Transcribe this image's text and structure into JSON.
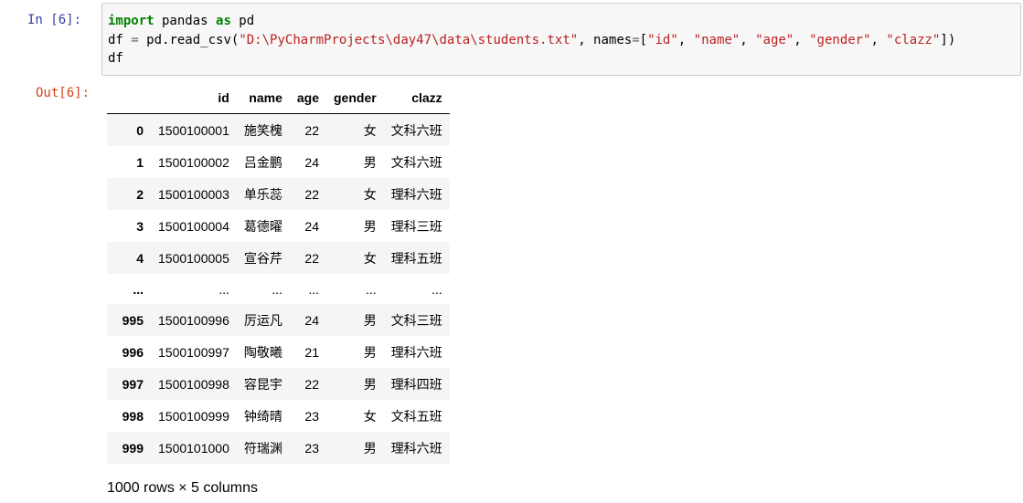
{
  "cell": {
    "in_prompt": "In  [6]:",
    "out_prompt": "Out[6]:",
    "code_lines": [
      {
        "kw1": "import",
        "t1": " pandas ",
        "kw2": "as",
        "t2": " pd"
      },
      {
        "t1": "df ",
        "op1": "=",
        "t2": " pd.read_csv(",
        "s1": "\"D:\\PyCharmProjects\\day47\\data\\students.txt\"",
        "t3": ", names",
        "op2": "=",
        "t4": "[",
        "s2": "\"id\"",
        "t5": ", ",
        "s3": "\"name\"",
        "t6": ", ",
        "s4": "\"age\"",
        "t7": ", ",
        "s5": "\"gender\"",
        "t8": ", ",
        "s6": "\"clazz\"",
        "t9": "])"
      },
      {
        "t1": "df"
      }
    ]
  },
  "dataframe": {
    "columns": [
      "",
      "id",
      "name",
      "age",
      "gender",
      "clazz"
    ],
    "rows": [
      {
        "index": "0",
        "id": "1500100001",
        "name": "施笑槐",
        "age": "22",
        "gender": "女",
        "clazz": "文科六班"
      },
      {
        "index": "1",
        "id": "1500100002",
        "name": "吕金鹏",
        "age": "24",
        "gender": "男",
        "clazz": "文科六班"
      },
      {
        "index": "2",
        "id": "1500100003",
        "name": "单乐蕊",
        "age": "22",
        "gender": "女",
        "clazz": "理科六班"
      },
      {
        "index": "3",
        "id": "1500100004",
        "name": "葛德曜",
        "age": "24",
        "gender": "男",
        "clazz": "理科三班"
      },
      {
        "index": "4",
        "id": "1500100005",
        "name": "宣谷芹",
        "age": "22",
        "gender": "女",
        "clazz": "理科五班"
      },
      {
        "index": "...",
        "id": "...",
        "name": "...",
        "age": "...",
        "gender": "...",
        "clazz": "..."
      },
      {
        "index": "995",
        "id": "1500100996",
        "name": "厉运凡",
        "age": "24",
        "gender": "男",
        "clazz": "文科三班"
      },
      {
        "index": "996",
        "id": "1500100997",
        "name": "陶敬曦",
        "age": "21",
        "gender": "男",
        "clazz": "理科六班"
      },
      {
        "index": "997",
        "id": "1500100998",
        "name": "容昆宇",
        "age": "22",
        "gender": "男",
        "clazz": "理科四班"
      },
      {
        "index": "998",
        "id": "1500100999",
        "name": "钟绮晴",
        "age": "23",
        "gender": "女",
        "clazz": "文科五班"
      },
      {
        "index": "999",
        "id": "1500101000",
        "name": "符瑞渊",
        "age": "23",
        "gender": "男",
        "clazz": "理科六班"
      }
    ],
    "shape_text": "1000 rows × 5 columns"
  },
  "colors": {
    "in_prompt": "#303f9f",
    "out_prompt": "#d84315",
    "keyword": "#008000",
    "string": "#ba2121",
    "operator": "#666666",
    "input_bg": "#f7f7f7",
    "input_border": "#cfcfcf",
    "row_stripe": "#f5f5f5"
  }
}
